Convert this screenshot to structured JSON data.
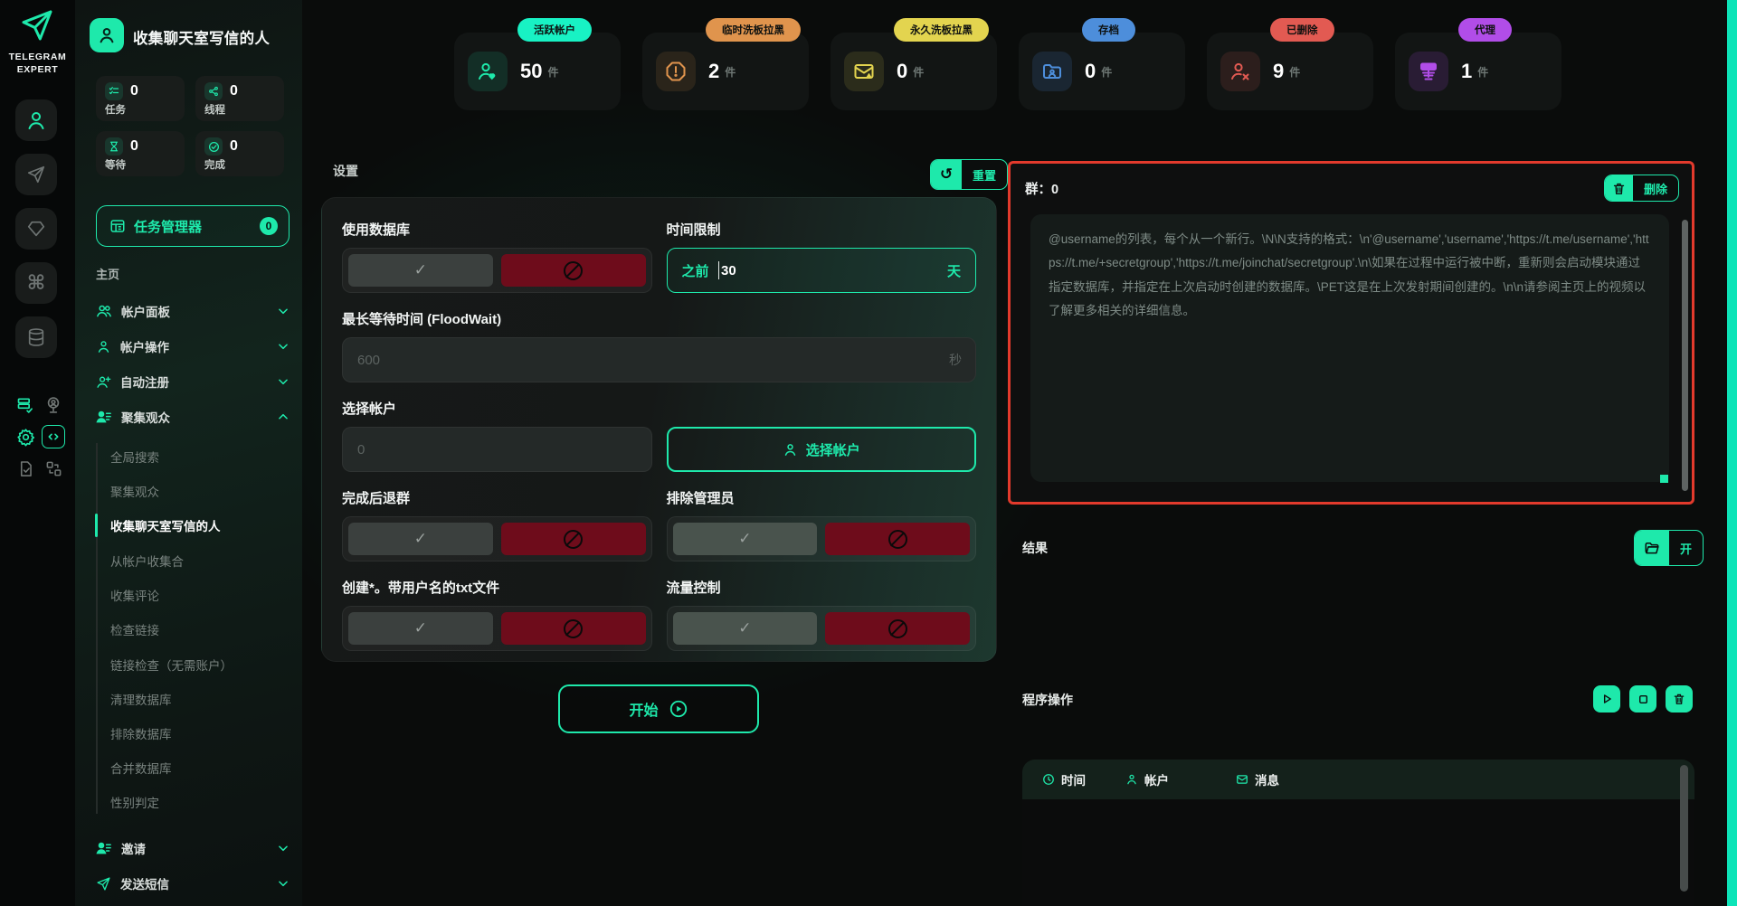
{
  "rail": {
    "logo_line1": "TELEGRAM",
    "logo_line2": "EXPERT"
  },
  "sidebar": {
    "title": "收集聊天室写信的人",
    "stats": [
      {
        "label": "任务",
        "value": "0"
      },
      {
        "label": "线程",
        "value": "0"
      },
      {
        "label": "等待",
        "value": "0"
      },
      {
        "label": "完成",
        "value": "0"
      }
    ],
    "task_manager": {
      "label": "任务管理器",
      "badge": "0"
    },
    "home_label": "主页",
    "menu": [
      {
        "label": "帐户面板"
      },
      {
        "label": "帐户操作"
      },
      {
        "label": "自动注册"
      },
      {
        "label": "聚集观众"
      }
    ],
    "submenu": [
      "全局搜索",
      "聚集观众",
      "收集聊天室写信的人",
      "从帐户收集合",
      "收集评论",
      "检查链接",
      "链接检查（无需账户）",
      "清理数据库",
      "排除数据库",
      "合并数据库",
      "性别判定"
    ],
    "active_submenu": "收集聊天室写信的人",
    "bottom_menu": [
      {
        "label": "邀请"
      },
      {
        "label": "发送短信"
      }
    ]
  },
  "stat_cards": [
    {
      "badge": "活跃帐户",
      "value": "50",
      "unit": "件",
      "badge_color": "#18f2c4",
      "icon": "person-heart-icon"
    },
    {
      "badge": "临时洗板拉黑",
      "value": "2",
      "unit": "件",
      "badge_color": "#e0944d",
      "icon": "octagon-alert-icon"
    },
    {
      "badge": "永久洗板拉黑",
      "value": "0",
      "unit": "件",
      "badge_color": "#e3d44f",
      "icon": "mail-alert-icon"
    },
    {
      "badge": "存档",
      "value": "0",
      "unit": "件",
      "badge_color": "#4d8edb",
      "icon": "folder-person-icon"
    },
    {
      "badge": "已删除",
      "value": "9",
      "unit": "件",
      "badge_color": "#e25a52",
      "icon": "person-x-icon"
    },
    {
      "badge": "代理",
      "value": "1",
      "unit": "件",
      "badge_color": "#b14de8",
      "icon": "proxy-server-icon"
    }
  ],
  "settings": {
    "title": "设置",
    "reset_label": "重置",
    "use_db_label": "使用数据库",
    "time_limit_label": "时间限制",
    "time_prefix": "之前",
    "time_value": "30",
    "time_suffix": "天",
    "floodwait_label": "最长等待时间 (FloodWait)",
    "floodwait_placeholder": "600",
    "floodwait_suffix": "秒",
    "select_account_label": "选择帐户",
    "select_account_placeholder": "0",
    "select_account_button": "选择帐户",
    "leave_after_label": "完成后退群",
    "exclude_admin_label": "排除管理员",
    "create_txt_label": "创建*。带用户名的txt文件",
    "traffic_label": "流量控制",
    "start_label": "开始"
  },
  "group_panel": {
    "title": "群：0",
    "delete_label": "删除",
    "placeholder": "@username的列表，每个从一个新行。\\N\\N支持的格式：\\n'@username','username','https://t.me/username','https://t.me/+secretgroup','https://t.me/joinchat/secretgroup'.\\n\\如果在过程中运行被中断，重新则会启动模块通过指定数据库，并指定在上次启动时创建的数据库。\\PET这是在上次发射期间创建的。\\n\\n请参阅主页上的视频以了解更多相关的详细信息。"
  },
  "results": {
    "label": "结果",
    "open_label": "开"
  },
  "operations": {
    "label": "程序操作",
    "headers": [
      {
        "label": "时间"
      },
      {
        "label": "帐户"
      },
      {
        "label": "消息"
      }
    ]
  },
  "colors": {
    "accent": "#1ee9ab",
    "highlight_border": "#e23a2c",
    "toggle_no_bg": "#6e0c1b",
    "scrollbar": "#0de4b8"
  }
}
